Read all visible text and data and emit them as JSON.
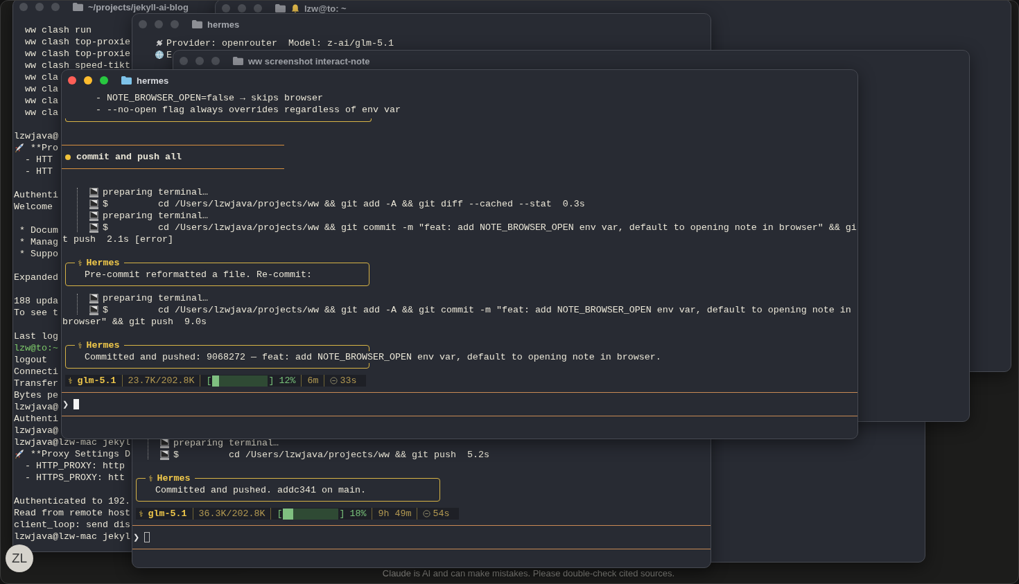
{
  "windows": [
    {
      "title": "~/projects/jekyll-ai-blog",
      "active": false,
      "blocks": [
        {
          "kind": "line",
          "text": "  ww clash run"
        },
        {
          "kind": "line",
          "text": "  ww clash top-proxie"
        },
        {
          "kind": "line",
          "text": "  ww clash top-proxie"
        },
        {
          "kind": "line",
          "text": "  ww clash speed-tikt"
        },
        {
          "kind": "line",
          "text": "  ww cla"
        },
        {
          "kind": "line",
          "text": "  ww cla"
        },
        {
          "kind": "line",
          "text": "  ww cla"
        },
        {
          "kind": "line",
          "text": "  ww cla"
        },
        {
          "kind": "line",
          "text": "lzwjava@",
          "space_before": true
        },
        {
          "kind": "rocket-line",
          "text": "**Pro"
        },
        {
          "kind": "line",
          "text": "  - HTT"
        },
        {
          "kind": "line",
          "text": "  - HTT"
        },
        {
          "kind": "line",
          "text": "Authenti",
          "space_before": true
        },
        {
          "kind": "line",
          "text": "Welcome"
        },
        {
          "kind": "line",
          "text": " * Docum",
          "space_before": true
        },
        {
          "kind": "line",
          "text": " * Manag"
        },
        {
          "kind": "line",
          "text": " * Suppo"
        },
        {
          "kind": "line",
          "text": "Expanded",
          "space_before": true
        },
        {
          "kind": "line",
          "text": "188 upda",
          "space_before": true
        },
        {
          "kind": "line",
          "text": "To see t"
        },
        {
          "kind": "line",
          "text": "Last log",
          "space_before": true
        },
        {
          "kind": "prompt-line",
          "text": "lzw@to:~"
        },
        {
          "kind": "line",
          "text": "logout"
        },
        {
          "kind": "line",
          "text": "Connecti"
        },
        {
          "kind": "line",
          "text": "Transfer"
        },
        {
          "kind": "line",
          "text": "Bytes pe"
        },
        {
          "kind": "line",
          "text": "lzwjava@"
        },
        {
          "kind": "line",
          "text": "Authenti"
        },
        {
          "kind": "line",
          "text": "lzwjava@"
        },
        {
          "kind": "line",
          "text": "lzwjava@lzw-mac jekyl"
        },
        {
          "kind": "rocket-line",
          "text": "**Proxy Settings D"
        },
        {
          "kind": "line",
          "text": "  - HTTP_PROXY: http"
        },
        {
          "kind": "line",
          "text": "  - HTTPS_PROXY: htt"
        },
        {
          "kind": "line",
          "text": "Authenticated to 192.",
          "space_before": true
        },
        {
          "kind": "line",
          "text": "Read from remote host"
        },
        {
          "kind": "line",
          "text": "client_loop: send dis"
        },
        {
          "kind": "line",
          "text": "lzwjava@lzw-mac jekyl"
        }
      ]
    },
    {
      "title": "lzw@to: ~",
      "active": false,
      "alert": true
    },
    {
      "title": "hermes",
      "active": false,
      "blocks": [
        {
          "kind": "info-line",
          "text": "Provider: openrouter  Model: z-ai/glm-5.1"
        },
        {
          "kind": "info-line",
          "text": "E"
        }
      ],
      "tail": [
        {
          "kind": "tool",
          "rows": [
            {
              "kind": "preparing",
              "text": "preparing terminal…"
            },
            {
              "kind": "command",
              "symbol": "$",
              "text": "cd /Users/lzwjava/projects/ww && git push  5.2s"
            }
          ]
        },
        {
          "kind": "hermes",
          "symbol": "⚕",
          "label": "Hermes",
          "text": "Committed and pushed. addc341 on main.",
          "space_before": true
        },
        {
          "kind": "status",
          "symbol": "⚕",
          "model": "glm-5.1",
          "tokens": "36.3K/202.8K",
          "open": "[",
          "level": 0.18,
          "close": "]",
          "percent": "18%",
          "elapsed": "9h 49m",
          "timer": "54s"
        },
        {
          "kind": "input",
          "caret": "❯",
          "focused": false
        }
      ]
    },
    {
      "title": "ww screenshot interact-note",
      "active": false
    },
    {
      "title": "hermes",
      "active": true,
      "blocks": [
        {
          "kind": "line",
          "text": "      - NOTE_BROWSER_OPEN=false → skips browser"
        },
        {
          "kind": "line",
          "text": "      - --no-open flag always overrides regardless of env var"
        },
        {
          "kind": "box-end"
        },
        {
          "kind": "task",
          "text": "commit and push all",
          "space_before": true
        },
        {
          "kind": "tool",
          "space_before": true,
          "rows": [
            {
              "kind": "preparing",
              "text": "preparing terminal…"
            },
            {
              "kind": "command",
              "symbol": "$",
              "text": "cd /Users/lzwjava/projects/ww && git add -A && git diff --cached --stat  0.3s"
            },
            {
              "kind": "preparing",
              "text": "preparing terminal…"
            },
            {
              "kind": "command",
              "symbol": "$",
              "text": "cd /Users/lzwjava/projects/ww && git commit -m \"feat: add NOTE_BROWSER_OPEN env var, default to opening note in browser\" && gi"
            }
          ]
        },
        {
          "kind": "wrap",
          "text": "t push  2.1s [error]"
        },
        {
          "kind": "hermes",
          "symbol": "⚕",
          "label": "Hermes",
          "text": "Pre-commit reformatted a file. Re-commit:",
          "space_before": true
        },
        {
          "kind": "tool",
          "rows": [
            {
              "kind": "preparing",
              "text": "preparing terminal…"
            },
            {
              "kind": "command",
              "symbol": "$",
              "text": "cd /Users/lzwjava/projects/ww && git add -A && git commit -m \"feat: add NOTE_BROWSER_OPEN env var, default to opening note in"
            }
          ]
        },
        {
          "kind": "wrap",
          "text": "browser\" && git push  9.0s"
        },
        {
          "kind": "hermes",
          "symbol": "⚕",
          "label": "Hermes",
          "text": "Committed and pushed: 9068272 — feat: add NOTE_BROWSER_OPEN env var, default to opening note in browser.",
          "space_before": true
        },
        {
          "kind": "status",
          "symbol": "⚕",
          "model": "glm-5.1",
          "tokens": "23.7K/202.8K",
          "open": "[",
          "level": 0.12,
          "close": "]",
          "percent": "12%",
          "elapsed": "6m",
          "timer": "33s"
        },
        {
          "kind": "input",
          "caret": "❯",
          "focused": true
        }
      ]
    }
  ],
  "avatar": "ZL",
  "disclaimer": "Claude is AI and can make mistakes. Please double-check cited sources."
}
